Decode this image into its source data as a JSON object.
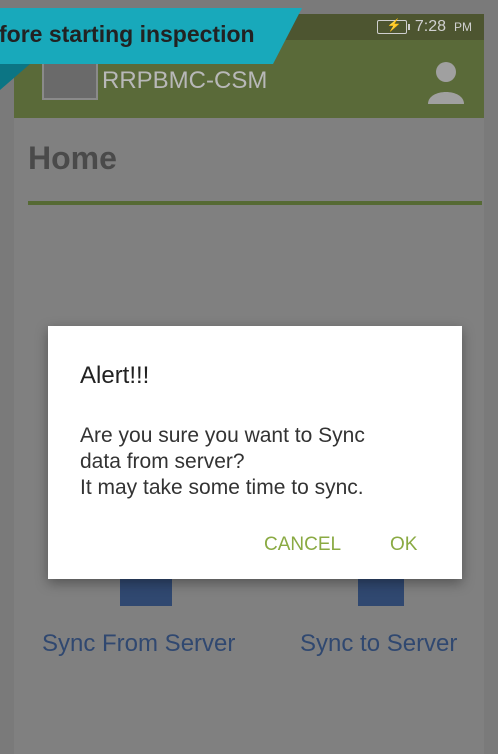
{
  "banner": {
    "text": "fore starting inspection"
  },
  "statusbar": {
    "time": "7:28",
    "ampm": "PM"
  },
  "appbar": {
    "title": "RRPBMC-CSM"
  },
  "page": {
    "title": "Home"
  },
  "tiles": [
    {
      "label": "Sync From Server"
    },
    {
      "label": "Sync to Server"
    }
  ],
  "dialog": {
    "title": "Alert!!!",
    "message": "Are you sure you want to  Sync\ndata from server?\nIt may take some time to sync.",
    "cancel": "CANCEL",
    "ok": "OK"
  }
}
